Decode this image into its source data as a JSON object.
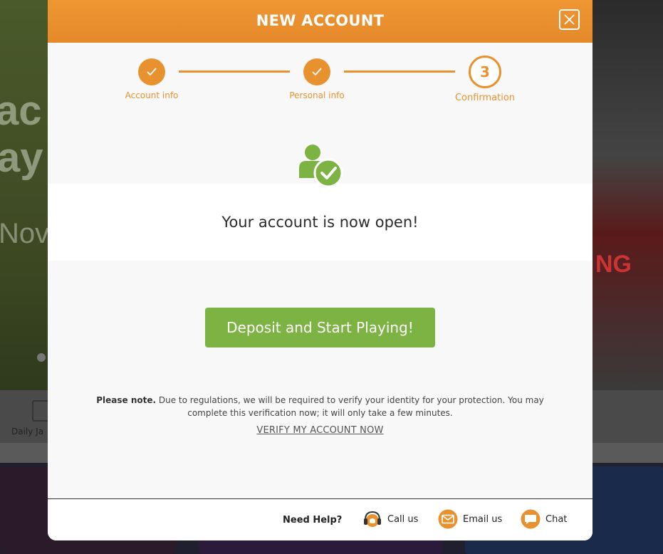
{
  "modal": {
    "title": "NEW ACCOUNT",
    "close_label": "close"
  },
  "stepper": {
    "steps": [
      {
        "label": "Account info",
        "state": "done"
      },
      {
        "label": "Personal info",
        "state": "done"
      },
      {
        "label": "Confirmation",
        "number": "3",
        "state": "current"
      }
    ],
    "accent_color": "#e8922f"
  },
  "success": {
    "icon": "user-check-icon",
    "message": "Your account is now open!",
    "icon_color": "#7cb342"
  },
  "cta": {
    "deposit_label": "Deposit and Start Playing!",
    "color": "#7cb342"
  },
  "note": {
    "bold": "Please note.",
    "text": " Due to regulations, we will be required to verify your identity for your protection. You may complete this verification now; it will only take a few minutes.",
    "verify_label": "VERIFY MY ACCOUNT NOW"
  },
  "footer": {
    "need_help": "Need Help?",
    "call_label": "Call us",
    "email_label": "Email us",
    "chat_label": "Chat"
  },
  "background": {
    "hero_line1": "ac",
    "hero_line2": "ay",
    "hero_line3": "Nov",
    "strip_label": "Daily Ja",
    "right_text": "NG"
  }
}
